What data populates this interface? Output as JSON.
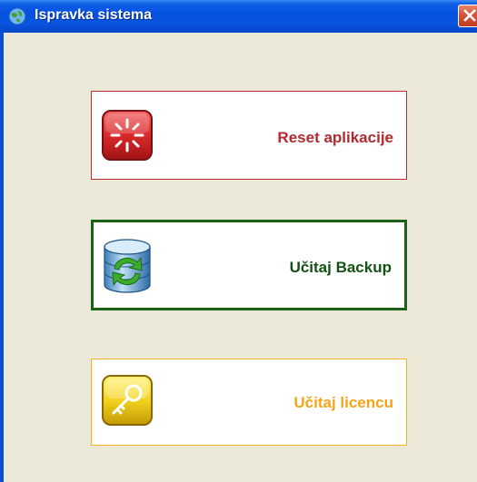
{
  "window": {
    "title": "Ispravka sistema",
    "icons": {
      "app": "globe-icon",
      "close": "close-icon"
    }
  },
  "buttons": [
    {
      "label": "Reset aplikacije",
      "icon": "reset-icon",
      "color": "#b22a2f"
    },
    {
      "label": "Učitaj Backup",
      "icon": "database-sync-icon",
      "color": "#145214"
    },
    {
      "label": "Učitaj licencu",
      "icon": "key-icon",
      "color": "#f3a41a"
    }
  ]
}
